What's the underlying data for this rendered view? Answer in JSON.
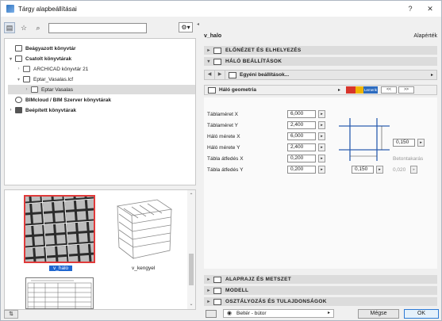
{
  "window": {
    "title": "Tárgy alapbeállításai",
    "help": "?",
    "close": "✕"
  },
  "library_tree": {
    "items": [
      {
        "label": "Beágyazott könyvtár",
        "bold": true,
        "twisty": "",
        "indent": 0
      },
      {
        "label": "Csatolt könyvtárak",
        "bold": true,
        "twisty": "▾",
        "indent": 0
      },
      {
        "label": "ARCHICAD könyvtár 21",
        "bold": false,
        "twisty": "›",
        "indent": 1
      },
      {
        "label": "Eptar_Vasalas.lcf",
        "bold": false,
        "twisty": "▾",
        "indent": 1
      },
      {
        "label": "Eptar Vasalas",
        "bold": false,
        "twisty": "›",
        "indent": 2
      },
      {
        "label": "BIMcloud / BIM Szerver könyvtárak",
        "bold": true,
        "twisty": "",
        "indent": 0
      },
      {
        "label": "Beépített könyvtárak",
        "bold": true,
        "twisty": "›",
        "indent": 0
      }
    ]
  },
  "previews": [
    {
      "label": "v_halo",
      "selected": true
    },
    {
      "label": "v_kengyel",
      "selected": false
    }
  ],
  "object": {
    "name": "v_halo",
    "defaults": "Alapérték"
  },
  "sections": {
    "elonezet": "ELŐNÉZET ÉS ELHELYEZÉS",
    "halo": "HÁLÓ BEÁLLÍTÁSOK",
    "alaprajz": "ALAPRAJZ ÉS METSZET",
    "modell": "MODELL",
    "osztalyozas": "OSZTÁLYOZÁS ÉS TULAJDONSÁGOK"
  },
  "settings_bar": {
    "label": "Egyéni beállítások..."
  },
  "geometry_bar": {
    "label": "Háló geometria",
    "logo_text": "Lemerik"
  },
  "params": [
    {
      "label": "Táblaméret X",
      "value": "6,000"
    },
    {
      "label": "Táblaméret Y",
      "value": "2,400"
    },
    {
      "label": "Háló mérete X",
      "value": "6,000"
    },
    {
      "label": "Háló mérete Y",
      "value": "2,400"
    },
    {
      "label": "Tábla átfedés X",
      "value": "0,200"
    },
    {
      "label": "Tábla átfedés Y",
      "value": "0,200"
    }
  ],
  "diagram": {
    "right_value": "0,150",
    "bottom_value": "0,150",
    "cover_label": "Betontakarás",
    "cover_value": "0,020"
  },
  "footer": {
    "layer": "Beltér - bútor",
    "cancel": "Mégse",
    "ok": "OK"
  }
}
